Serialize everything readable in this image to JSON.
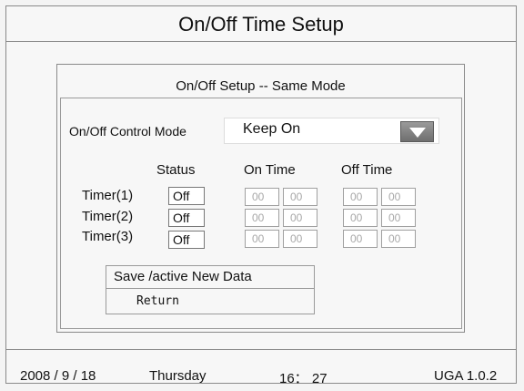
{
  "header": {
    "title": "On/Off  Time Setup"
  },
  "dialog": {
    "title": "On/Off Setup -- Same Mode",
    "mode_label": "On/Off Control Mode",
    "mode_value": "Keep On",
    "col_status": "Status",
    "col_on_time": "On Time",
    "col_off_time": "Off Time",
    "timers": [
      {
        "label": "Timer(1)",
        "status": "Off",
        "on_h": "00",
        "on_m": "00",
        "off_h": "00",
        "off_m": "00"
      },
      {
        "label": "Timer(2)",
        "status": "Off",
        "on_h": "00",
        "on_m": "00",
        "off_h": "00",
        "off_m": "00"
      },
      {
        "label": "Timer(3)",
        "status": "Off",
        "on_h": "00",
        "on_m": "00",
        "off_h": "00",
        "off_m": "00"
      }
    ],
    "save_label": "Save /active New Data",
    "return_label": "Return"
  },
  "status_bar": {
    "date": "2008 / 9 / 18",
    "weekday": "Thursday",
    "time": "16： 27",
    "version": "UGA 1.0.2"
  }
}
